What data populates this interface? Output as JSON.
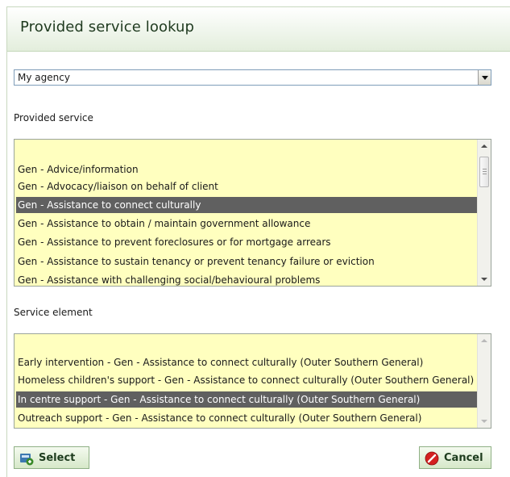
{
  "dialog": {
    "title": "Provided service lookup"
  },
  "agency_select": {
    "value": "My agency"
  },
  "provided_service": {
    "label": "Provided service",
    "items": [
      "Gen - Advice/information",
      "Gen - Advocacy/liaison on behalf of client",
      "Gen - Assistance to connect culturally",
      "Gen - Assistance to obtain / maintain government allowance",
      "Gen - Assistance to prevent foreclosures or for mortgage arrears",
      "Gen - Assistance to sustain tenancy or prevent tenancy failure or eviction",
      "Gen - Assistance with challenging social/behavioural problems"
    ],
    "selected_index": 2
  },
  "service_element": {
    "label": "Service element",
    "items": [
      "Early intervention - Gen - Assistance to connect culturally (Outer Southern General)",
      "Homeless children's support - Gen - Assistance to connect culturally (Outer Southern General)",
      "In centre support - Gen - Assistance to connect culturally (Outer Southern General)",
      "Outreach support - Gen - Assistance to connect culturally (Outer Southern General)"
    ],
    "selected_index": 2
  },
  "buttons": {
    "select_label": "Select",
    "cancel_label": "Cancel"
  },
  "colors": {
    "list_background": "#ffffbf",
    "selected_row": "#606060",
    "title_bar": "#e3eedc",
    "button_text": "#1e3c1e",
    "cancel_icon": "#d42020",
    "select_icon": "#3a8a2a"
  },
  "icons": {
    "select": "select-icon",
    "cancel": "cancel-icon",
    "dropdown": "chevron-down-icon"
  }
}
